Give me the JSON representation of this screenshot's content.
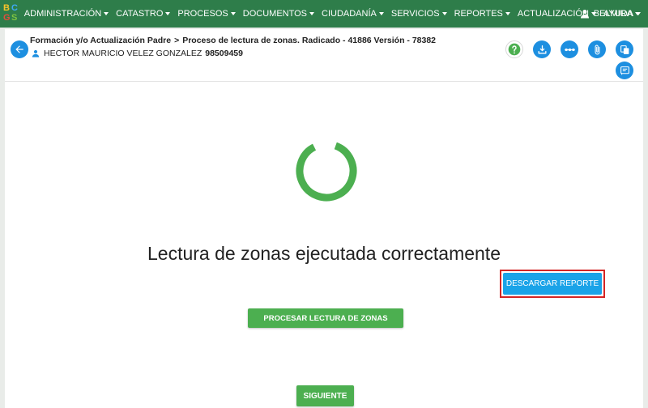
{
  "logo": {
    "letters": [
      "B",
      "C",
      "G",
      "S"
    ],
    "colors": [
      "#f6c32a",
      "#3fa9f5",
      "#e64b3c",
      "#7dc242"
    ]
  },
  "nav": {
    "items": [
      {
        "label": "ADMINISTRACIÓN"
      },
      {
        "label": "CATASTRO"
      },
      {
        "label": "PROCESOS"
      },
      {
        "label": "DOCUMENTOS"
      },
      {
        "label": "CIUDADANÍA"
      },
      {
        "label": "SERVICIOS"
      },
      {
        "label": "REPORTES"
      },
      {
        "label": "ACTUALIZACIÓN"
      },
      {
        "label": "AYUDA"
      }
    ],
    "user": {
      "name": "BELMIRA",
      "icon": "user-icon"
    },
    "background": "#2e7d4a"
  },
  "header": {
    "breadcrumb_parent": "Formación y/o Actualización Padre",
    "breadcrumb_separator": ">",
    "breadcrumb_current": "Proceso de lectura de zonas. Radicado - 41886 Versión - 78382",
    "owner_name": "HECTOR MAURICIO VELEZ GONZALEZ",
    "owner_id": "98509459"
  },
  "toolbar": {
    "icons": [
      "help-icon",
      "download-icon",
      "timeline-icon",
      "attach-icon",
      "copy-icon",
      "notes-icon"
    ],
    "accent": "#1d8fe0"
  },
  "status": {
    "message": "Lectura de zonas ejecutada correctamente",
    "spinner_color": "#4caf50"
  },
  "actions": {
    "download_report": "DESCARGAR REPORTE",
    "process_zones": "PROCESAR LECTURA DE ZONAS",
    "next": "SIGUIENTE"
  }
}
